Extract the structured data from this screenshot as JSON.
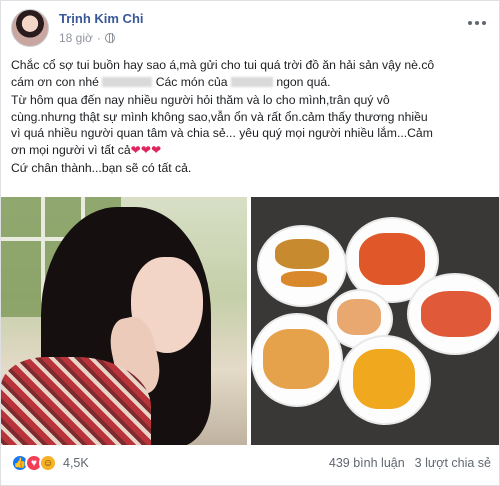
{
  "post": {
    "author": "Trịnh Kim Chi",
    "time": "18 giờ",
    "paragraphs": [
      {
        "line1": "Chắc cổ sợ tui buồn hay sao á,mà gửi cho tui quá trời đồ ăn hải sản vậy nè.cô",
        "line2a": "cám ơn con nhé",
        "line2b": "Các món của",
        "line2c": "ngon quá."
      },
      {
        "line1": "Từ hôm qua đến nay nhiều người hỏi thăm và lo cho mình,trân quý vô",
        "line2": "cùng.nhưng thật sự mình không sao,vẫn ổn và rất ổn.cảm thấy thương nhiều",
        "line3": "vì quá nhiều người quan tâm và chia sẻ... yêu quý mọi người nhiều lắm...Cảm",
        "line4": "ơn mọi người vì tất cả",
        "hearts": "❤❤❤"
      },
      {
        "line1": "Cứ chân thành...bạn sẽ có tất cả."
      }
    ]
  },
  "footer": {
    "reaction_count": "4,5K",
    "comments": "439 bình luận",
    "shares": "3 lượt chia sẻ"
  },
  "icons": {
    "like": "like-icon",
    "love": "love-icon",
    "haha": "haha-icon",
    "globe": "globe-icon",
    "more": "more-icon"
  },
  "colors": {
    "author": "#385898",
    "like": "#1877f2",
    "love": "#f33e58",
    "haha": "#f7b125"
  }
}
